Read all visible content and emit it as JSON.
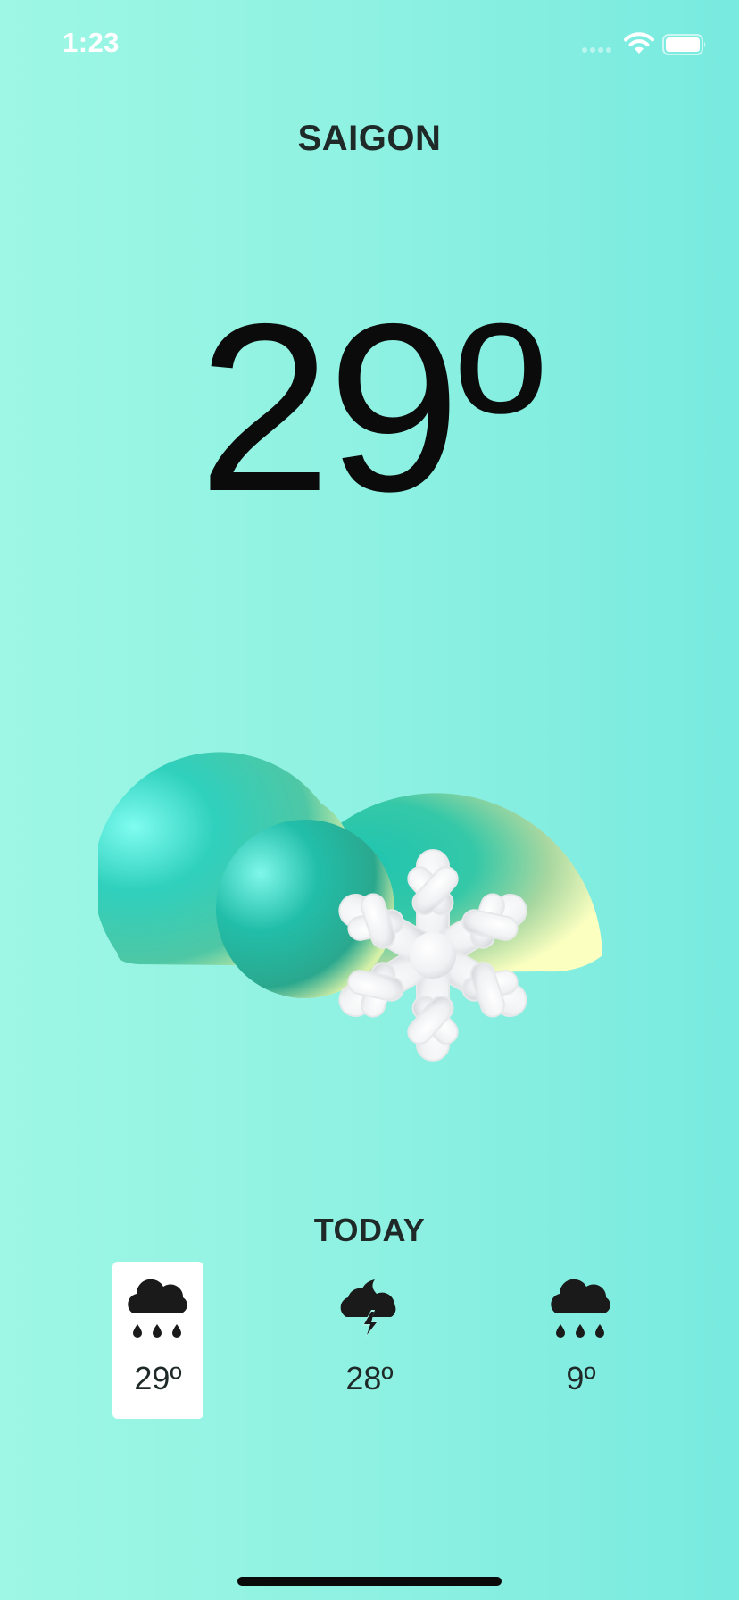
{
  "status_bar": {
    "time": "1:23",
    "signal_icon": "cellular-signal-icon",
    "wifi_icon": "wifi-icon",
    "battery_icon": "battery-icon"
  },
  "city": "SAIGON",
  "current": {
    "temperature": "29º",
    "condition_icon": "cloud-snow-icon"
  },
  "today": {
    "label": "TODAY",
    "items": [
      {
        "icon": "cloud-rain-icon",
        "temp": "29º",
        "selected": true
      },
      {
        "icon": "cloud-thunder-icon",
        "temp": "28º",
        "selected": false
      },
      {
        "icon": "cloud-rain-icon",
        "temp": "9º",
        "selected": false
      }
    ]
  },
  "colors": {
    "background_left": "#9ef7e4",
    "background_right": "#78eadf",
    "text_dark": "#1f2a28",
    "selected_card": "#ffffff"
  }
}
